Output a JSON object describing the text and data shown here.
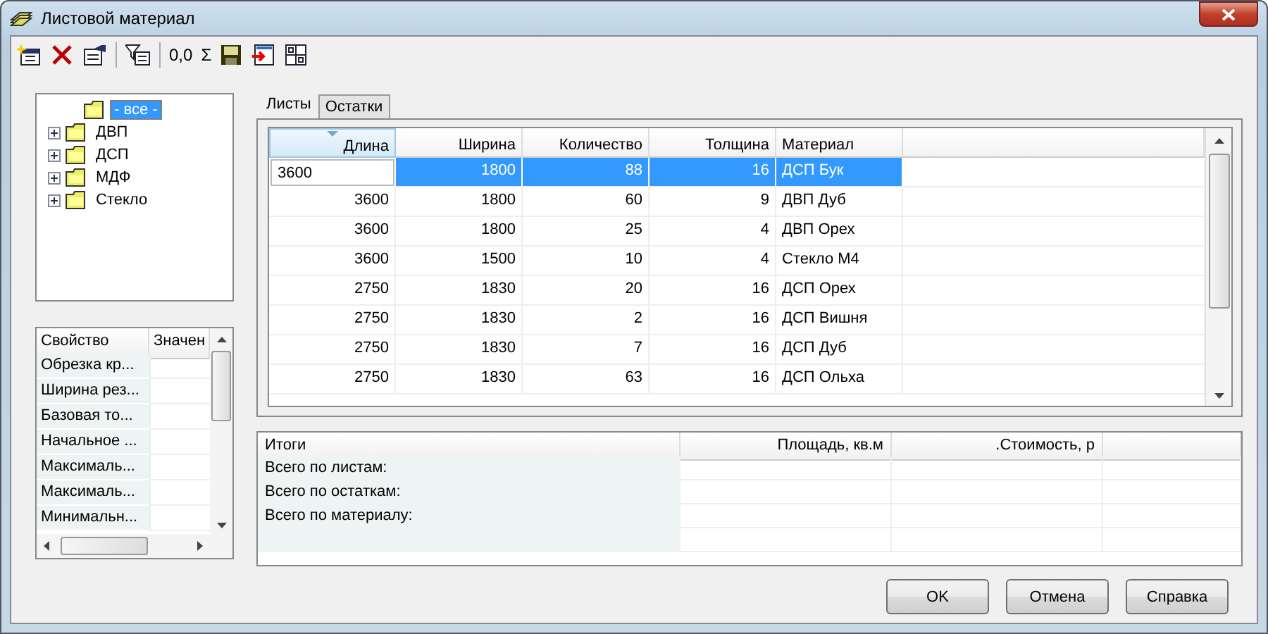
{
  "window": {
    "title": "Листовой материал"
  },
  "toolbar": [
    {
      "kind": "new"
    },
    {
      "kind": "delete"
    },
    {
      "kind": "edit"
    },
    {
      "kind": "separator"
    },
    {
      "kind": "filter"
    },
    {
      "kind": "separator"
    },
    {
      "kind": "text",
      "label": "0,0"
    },
    {
      "kind": "text",
      "label": "Σ"
    },
    {
      "kind": "save"
    },
    {
      "kind": "export"
    },
    {
      "kind": "grid"
    }
  ],
  "tree": {
    "items": [
      {
        "label": "- все -",
        "selected": true,
        "expandable": false
      },
      {
        "label": "ДВП",
        "selected": false,
        "expandable": true
      },
      {
        "label": "ДСП",
        "selected": false,
        "expandable": true
      },
      {
        "label": "МДФ",
        "selected": false,
        "expandable": true
      },
      {
        "label": "Стекло",
        "selected": false,
        "expandable": true
      }
    ]
  },
  "properties": {
    "columns": [
      "Свойство",
      "Значен"
    ],
    "rows": [
      "Обрезка кр...",
      "Ширина рез...",
      "Базовая то...",
      "Начальное ...",
      "Максималь...",
      "Максималь...",
      "Минимальн..."
    ]
  },
  "tabs": [
    {
      "label": "Листы",
      "selected": true
    },
    {
      "label": "Остатки",
      "selected": false
    }
  ],
  "sheets": {
    "columns": [
      {
        "label": "Длина",
        "sorted": true
      },
      {
        "label": "Ширина",
        "sorted": false
      },
      {
        "label": "Количество",
        "sorted": false
      },
      {
        "label": "Толщина",
        "sorted": false
      },
      {
        "label": "Материал",
        "sorted": false
      }
    ],
    "rows": [
      {
        "cells": [
          "3600",
          "1800",
          "88",
          "16",
          "ДСП Бук"
        ],
        "selected": true,
        "editing": true
      },
      {
        "cells": [
          "3600",
          "1800",
          "60",
          "9",
          "ДВП Дуб"
        ],
        "selected": false,
        "editing": false
      },
      {
        "cells": [
          "3600",
          "1800",
          "25",
          "4",
          "ДВП Орех"
        ],
        "selected": false,
        "editing": false
      },
      {
        "cells": [
          "3600",
          "1500",
          "10",
          "4",
          "Стекло М4"
        ],
        "selected": false,
        "editing": false
      },
      {
        "cells": [
          "2750",
          "1830",
          "20",
          "16",
          "ДСП Орех"
        ],
        "selected": false,
        "editing": false
      },
      {
        "cells": [
          "2750",
          "1830",
          "2",
          "16",
          "ДСП Вишня"
        ],
        "selected": false,
        "editing": false
      },
      {
        "cells": [
          "2750",
          "1830",
          "7",
          "16",
          "ДСП Дуб"
        ],
        "selected": false,
        "editing": false
      },
      {
        "cells": [
          "2750",
          "1830",
          "63",
          "16",
          "ДСП Ольха"
        ],
        "selected": false,
        "editing": false
      }
    ]
  },
  "totals": {
    "columns": [
      "Итоги",
      "Площадь, кв.м",
      ".Стоимость, р"
    ],
    "rows": [
      "Всего по листам:",
      "Всего по остаткам:",
      "Всего по материалу:"
    ]
  },
  "buttons": [
    "OK",
    "Отмена",
    "Справка"
  ]
}
